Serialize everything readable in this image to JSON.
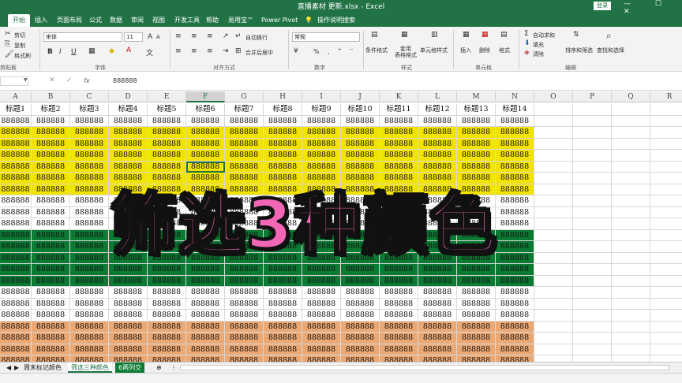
{
  "window": {
    "title": "直播素材 更新.xlsx - Excel",
    "login": "登录",
    "controls": "— ☐ ✕"
  },
  "ribbon_tabs": [
    "开始",
    "插入",
    "页面布局",
    "公式",
    "数据",
    "审阅",
    "视图",
    "开发工具",
    "帮助",
    "易用宝™",
    "Power Pivot",
    "操作说明搜索"
  ],
  "clipboard": {
    "cut": "剪切",
    "copy": "复制",
    "painter": "格式刷",
    "group": "剪贴板"
  },
  "font": {
    "name": "宋体",
    "size": "11",
    "group": "字体",
    "bold": "B",
    "italic": "I",
    "underline": "U",
    "grow": "A",
    "shrink": "A"
  },
  "alignment": {
    "wrap": "自动换行",
    "merge": "合并后居中",
    "group": "对齐方式"
  },
  "number": {
    "format": "常规",
    "percent": "%",
    "comma": ",",
    "group": "数字"
  },
  "styles": {
    "conditional": "条件格式",
    "table": "套用\n表格格式",
    "cell": "单元格样式",
    "group": "样式"
  },
  "cells": {
    "insert": "插入",
    "delete": "删除",
    "format": "格式",
    "group": "单元格"
  },
  "editing": {
    "autosum": "自动求和",
    "fill": "填充",
    "clear": "清除",
    "sort": "排序和筛选",
    "find": "查找和选择",
    "group": "编辑"
  },
  "formula_bar": {
    "name_box": "",
    "fx": "fx",
    "value": "888888"
  },
  "columns": [
    "A",
    "B",
    "C",
    "D",
    "E",
    "F",
    "G",
    "H",
    "I",
    "J",
    "K",
    "L",
    "M",
    "N",
    "O",
    "P",
    "Q",
    "R"
  ],
  "selected_column": "F",
  "header_row": [
    "标题1",
    "标题2",
    "标题3",
    "标题4",
    "标题5",
    "标题6",
    "标题7",
    "标题8",
    "标题9",
    "标题10",
    "标题11",
    "标题12",
    "标题13",
    "标题14"
  ],
  "cell_value": "888888",
  "row_fills": [
    "#ffffff",
    "#f3e300",
    "#f3e300",
    "#f3e300",
    "#f3e300",
    "#f3e300",
    "#f3e300",
    "#ffffff",
    "#ffffff",
    "#ffffff",
    "#0b7a33",
    "#0b7a33",
    "#0b7a33",
    "#0b7a33",
    "#0b7a33",
    "#ffffff",
    "#ffffff",
    "#ffffff",
    "#eca873",
    "#eca873",
    "#eca873",
    "#eca873"
  ],
  "overlay_text": "筛选3种颜色",
  "sheet_tabs": [
    "周末标记颜色",
    "筛选三种颜色",
    "6两列交"
  ],
  "active_sheet": 1,
  "colors": {
    "excel_green": "#217346",
    "overlay_pink": "#f267b5"
  }
}
